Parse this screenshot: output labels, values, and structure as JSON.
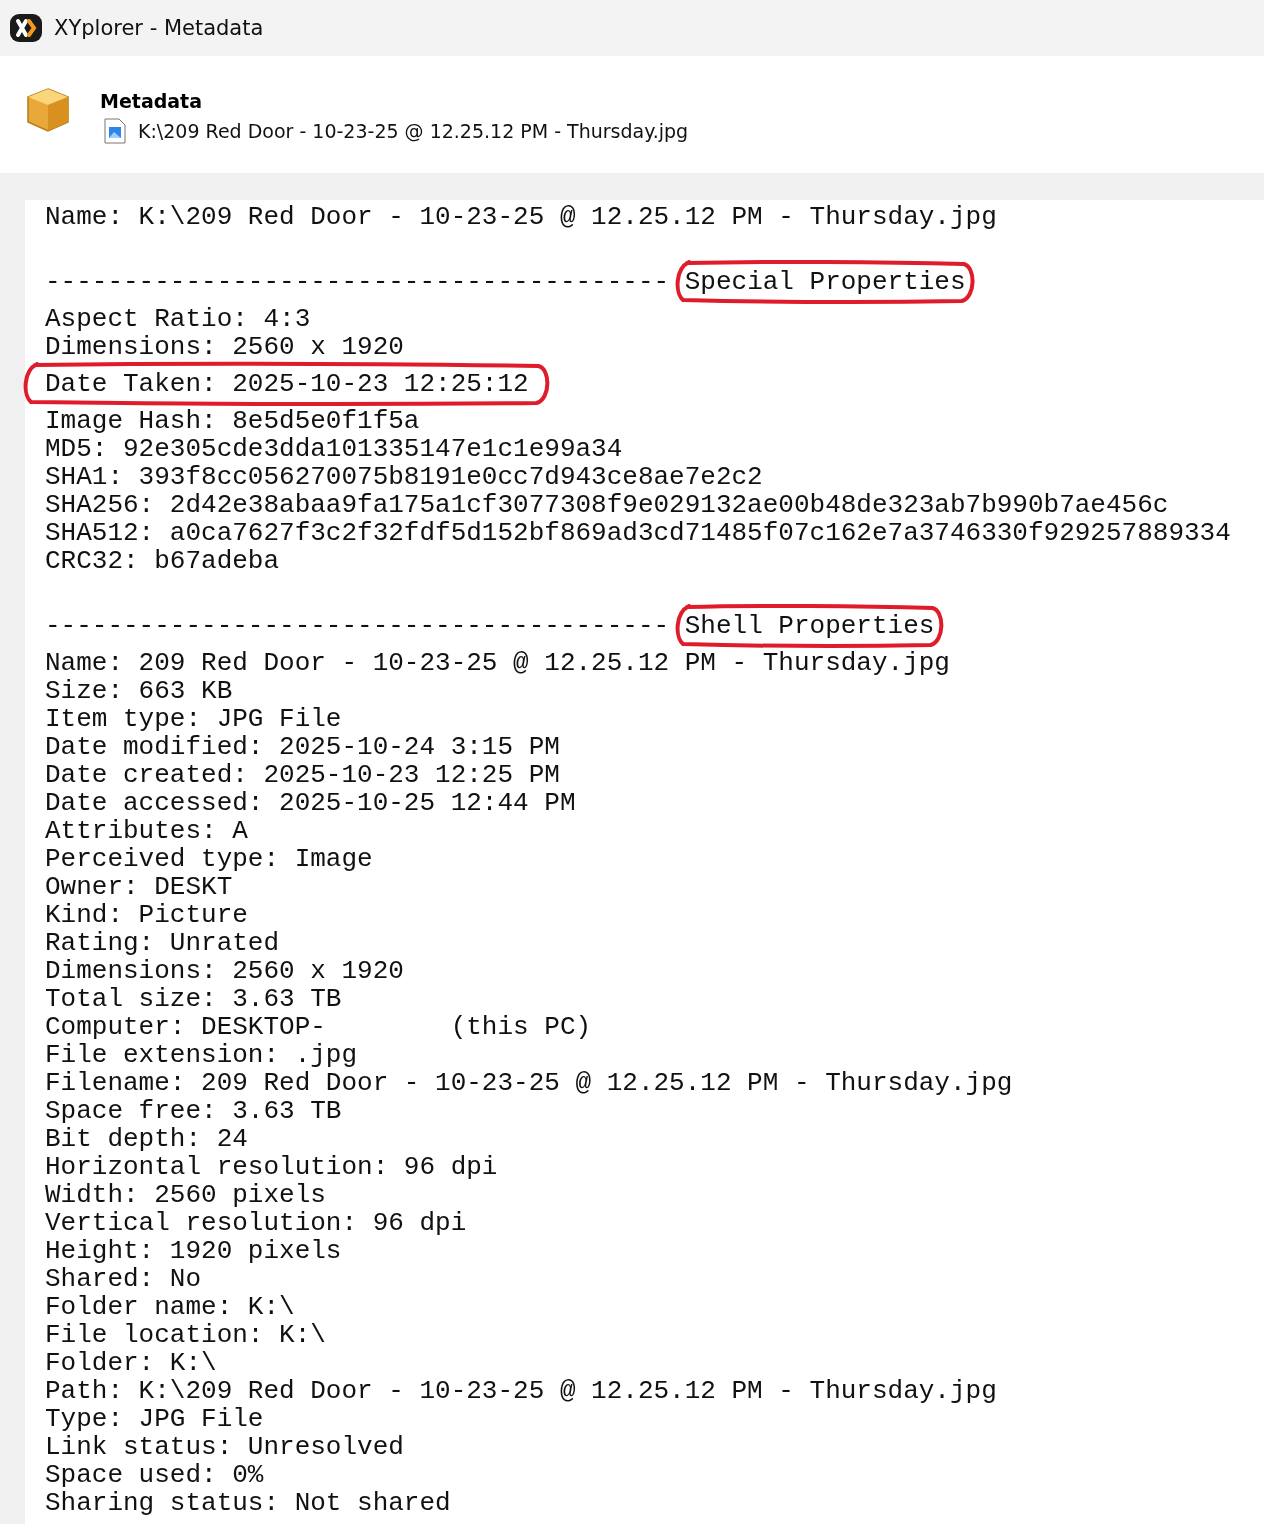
{
  "window": {
    "title": "XYplorer - Metadata"
  },
  "header": {
    "heading": "Metadata",
    "file_path": "K:\\209 Red Door - 10-23-25 @ 12.25.12 PM - Thursday.jpg"
  },
  "lines": [
    {
      "kind": "text",
      "text": "Name: K:\\209 Red Door - 10-23-25 @ 12.25.12 PM - Thursday.jpg",
      "circled": false
    },
    {
      "kind": "blank"
    },
    {
      "kind": "separator",
      "text": "----------------------------------------",
      "label": "Special Properties",
      "circled": true
    },
    {
      "kind": "text",
      "text": "Aspect Ratio: 4:3",
      "circled": false
    },
    {
      "kind": "text",
      "text": "Dimensions: 2560 x 1920",
      "circled": false
    },
    {
      "kind": "text",
      "text": "Date Taken: 2025-10-23 12:25:12",
      "circled": true
    },
    {
      "kind": "text",
      "text": "Image Hash: 8e5d5e0f1f5a",
      "circled": false
    },
    {
      "kind": "text",
      "text": "MD5: 92e305cde3dda101335147e1c1e99a34",
      "circled": false
    },
    {
      "kind": "text",
      "text": "SHA1: 393f8cc056270075b8191e0cc7d943ce8ae7e2c2",
      "circled": false
    },
    {
      "kind": "text",
      "text": "SHA256: 2d42e38abaa9fa175a1cf3077308f9e029132ae00b48de323ab7b990b7ae456c",
      "circled": false
    },
    {
      "kind": "text",
      "text": "SHA512: a0ca7627f3c2f32fdf5d152bf869ad3cd71485f07c162e7a3746330f929257889334",
      "circled": false
    },
    {
      "kind": "text",
      "text": "CRC32: b67adeba",
      "circled": false
    },
    {
      "kind": "blank"
    },
    {
      "kind": "separator",
      "text": "----------------------------------------",
      "label": "Shell Properties",
      "circled": true
    },
    {
      "kind": "text",
      "text": "Name: 209 Red Door - 10-23-25 @ 12.25.12 PM - Thursday.jpg",
      "circled": false
    },
    {
      "kind": "text",
      "text": "Size: 663 KB",
      "circled": false
    },
    {
      "kind": "text",
      "text": "Item type: JPG File",
      "circled": false
    },
    {
      "kind": "text",
      "text": "Date modified: 2025-10-24 3:15 PM",
      "circled": false
    },
    {
      "kind": "text",
      "text": "Date created: 2025-10-23 12:25 PM",
      "circled": false
    },
    {
      "kind": "text",
      "text": "Date accessed: 2025-10-25 12:44 PM",
      "circled": false
    },
    {
      "kind": "text",
      "text": "Attributes: A",
      "circled": false
    },
    {
      "kind": "text",
      "text": "Perceived type: Image",
      "circled": false
    },
    {
      "kind": "text",
      "text": "Owner: DESKT",
      "circled": false
    },
    {
      "kind": "text",
      "text": "Kind: Picture",
      "circled": false
    },
    {
      "kind": "text",
      "text": "Rating: Unrated",
      "circled": false
    },
    {
      "kind": "text",
      "text": "Dimensions: 2560 x 1920",
      "circled": false
    },
    {
      "kind": "text",
      "text": "Total size: 3.63 TB",
      "circled": false
    },
    {
      "kind": "text",
      "text": "Computer: DESKTOP-        (this PC)",
      "circled": false
    },
    {
      "kind": "text",
      "text": "File extension: .jpg",
      "circled": false
    },
    {
      "kind": "text",
      "text": "Filename: 209 Red Door - 10-23-25 @ 12.25.12 PM - Thursday.jpg",
      "circled": false
    },
    {
      "kind": "text",
      "text": "Space free: 3.63 TB",
      "circled": false
    },
    {
      "kind": "text",
      "text": "Bit depth: 24",
      "circled": false
    },
    {
      "kind": "text",
      "text": "Horizontal resolution: 96 dpi",
      "circled": false
    },
    {
      "kind": "text",
      "text": "Width: 2560 pixels",
      "circled": false
    },
    {
      "kind": "text",
      "text": "Vertical resolution: 96 dpi",
      "circled": false
    },
    {
      "kind": "text",
      "text": "Height: 1920 pixels",
      "circled": false
    },
    {
      "kind": "text",
      "text": "Shared: No",
      "circled": false
    },
    {
      "kind": "text",
      "text": "Folder name: K:\\",
      "circled": false
    },
    {
      "kind": "text",
      "text": "File location: K:\\",
      "circled": false
    },
    {
      "kind": "text",
      "text": "Folder: K:\\",
      "circled": false
    },
    {
      "kind": "text",
      "text": "Path: K:\\209 Red Door - 10-23-25 @ 12.25.12 PM - Thursday.jpg",
      "circled": false
    },
    {
      "kind": "text",
      "text": "Type: JPG File",
      "circled": false
    },
    {
      "kind": "text",
      "text": "Link status: Unresolved",
      "circled": false
    },
    {
      "kind": "text",
      "text": "Space used: 0%",
      "circled": false
    },
    {
      "kind": "text",
      "text": "Sharing status: Not shared",
      "circled": false
    }
  ]
}
